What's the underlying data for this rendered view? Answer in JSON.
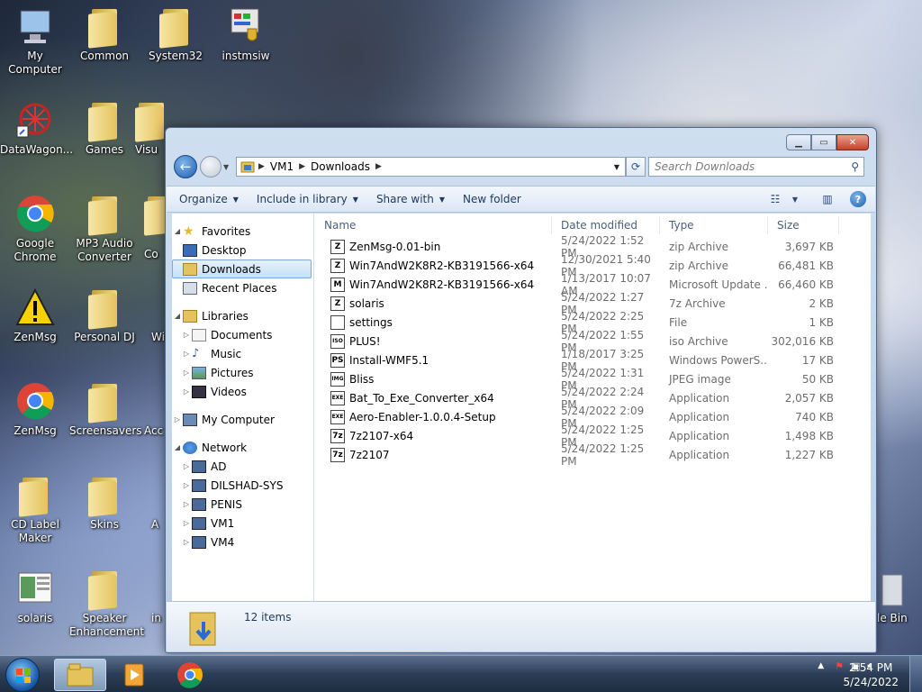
{
  "desktop": {
    "icons": [
      {
        "label": "My Computer"
      },
      {
        "label": "Common"
      },
      {
        "label": "System32"
      },
      {
        "label": "instmsiw"
      },
      {
        "label": "DataWagon..."
      },
      {
        "label": "Games"
      },
      {
        "label": "Visu"
      },
      {
        "label": "Google Chrome"
      },
      {
        "label": "MP3 Audio Converter"
      },
      {
        "label": "Co"
      },
      {
        "label": "ZenMsg"
      },
      {
        "label": "Personal DJ"
      },
      {
        "label": "Wi"
      },
      {
        "label": "ZenMsg"
      },
      {
        "label": "Screensavers"
      },
      {
        "label": "Acc"
      },
      {
        "label": "CD Label Maker"
      },
      {
        "label": "Skins"
      },
      {
        "label": "A"
      },
      {
        "label": "solaris"
      },
      {
        "label": "Speaker Enhancement"
      },
      {
        "label": "in"
      },
      {
        "label": "le Bin"
      }
    ]
  },
  "window": {
    "address": {
      "crumbs": [
        "VM1",
        "Downloads"
      ]
    },
    "search": {
      "placeholder": "Search Downloads"
    },
    "toolbar": {
      "organize": "Organize",
      "include": "Include in library",
      "share": "Share with",
      "new_folder": "New folder"
    },
    "nav": {
      "favorites": "Favorites",
      "desktop": "Desktop",
      "downloads": "Downloads",
      "recent": "Recent Places",
      "libraries": "Libraries",
      "documents": "Documents",
      "music": "Music",
      "pictures": "Pictures",
      "videos": "Videos",
      "my_computer": "My Computer",
      "network": "Network",
      "ad": "AD",
      "dilshad": "DILSHAD-SYS",
      "penis": "PENIS",
      "vm1": "VM1",
      "vm4": "VM4"
    },
    "columns": {
      "name": "Name",
      "date": "Date modified",
      "type": "Type",
      "size": "Size"
    },
    "files": [
      {
        "name": "ZenMsg-0.01-bin",
        "date": "5/24/2022 1:52 PM",
        "type": "zip Archive",
        "size": "3,697 KB",
        "icon": "Z"
      },
      {
        "name": "Win7AndW2K8R2-KB3191566-x64",
        "date": "12/30/2021 5:40 PM",
        "type": "zip Archive",
        "size": "66,481 KB",
        "icon": "Z"
      },
      {
        "name": "Win7AndW2K8R2-KB3191566-x64",
        "date": "1/13/2017 10:07 AM",
        "type": "Microsoft Update ...",
        "size": "66,460 KB",
        "icon": "M"
      },
      {
        "name": "solaris",
        "date": "5/24/2022 1:27 PM",
        "type": "7z Archive",
        "size": "2 KB",
        "icon": "Z"
      },
      {
        "name": "settings",
        "date": "5/24/2022 2:25 PM",
        "type": "File",
        "size": "1 KB",
        "icon": ""
      },
      {
        "name": "PLUS!",
        "date": "5/24/2022 1:55 PM",
        "type": "iso Archive",
        "size": "302,016 KB",
        "icon": "ISO"
      },
      {
        "name": "Install-WMF5.1",
        "date": "1/18/2017 3:25 PM",
        "type": "Windows PowerS...",
        "size": "17 KB",
        "icon": "PS"
      },
      {
        "name": "Bliss",
        "date": "5/24/2022 1:31 PM",
        "type": "JPEG image",
        "size": "50 KB",
        "icon": "IMG"
      },
      {
        "name": "Bat_To_Exe_Converter_x64",
        "date": "5/24/2022 2:24 PM",
        "type": "Application",
        "size": "2,057 KB",
        "icon": "EXE"
      },
      {
        "name": "Aero-Enabler-1.0.0.4-Setup",
        "date": "5/24/2022 2:09 PM",
        "type": "Application",
        "size": "740 KB",
        "icon": "EXE"
      },
      {
        "name": "7z2107-x64",
        "date": "5/24/2022 1:25 PM",
        "type": "Application",
        "size": "1,498 KB",
        "icon": "7z"
      },
      {
        "name": "7z2107",
        "date": "5/24/2022 1:25 PM",
        "type": "Application",
        "size": "1,227 KB",
        "icon": "7z"
      }
    ],
    "details": {
      "count": "12 items"
    }
  },
  "taskbar": {
    "time": "2:54 PM",
    "date": "5/24/2022"
  }
}
